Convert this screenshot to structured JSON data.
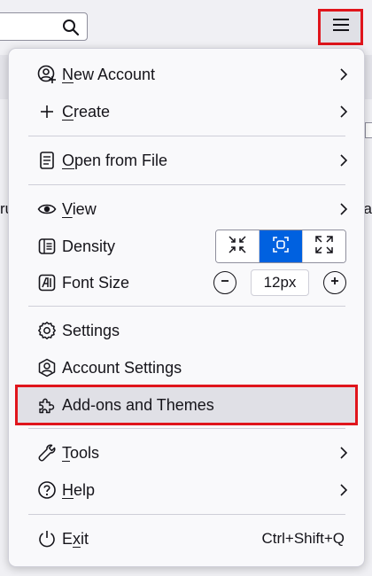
{
  "toolbar": {
    "search_icon": "search-icon",
    "app_menu_icon": "hamburger-icon"
  },
  "background": {
    "left_fragment": "ru",
    "right_fragment": "na"
  },
  "menu": {
    "new_account": {
      "pre": "",
      "mnemonic": "N",
      "post": "ew Account"
    },
    "create": {
      "pre": "",
      "mnemonic": "C",
      "post": "reate"
    },
    "open_from_file": {
      "pre": "",
      "mnemonic": "O",
      "post": "pen from File"
    },
    "view": {
      "pre": "",
      "mnemonic": "V",
      "post": "iew"
    },
    "density": {
      "label": "Density",
      "selected": "normal"
    },
    "font_size": {
      "label": "Font Size",
      "value": "12px"
    },
    "settings": {
      "label": "Settings"
    },
    "account_settings": {
      "label": "Account Settings"
    },
    "addons": {
      "label": "Add-ons and Themes"
    },
    "tools": {
      "pre": "",
      "mnemonic": "T",
      "post": "ools"
    },
    "help": {
      "pre": "",
      "mnemonic": "H",
      "post": "elp"
    },
    "exit": {
      "pre": "E",
      "mnemonic": "x",
      "post": "it",
      "shortcut": "Ctrl+Shift+Q"
    }
  },
  "colors": {
    "accent": "#0061e0",
    "highlight_border": "#e0151c",
    "text": "#15141a"
  }
}
